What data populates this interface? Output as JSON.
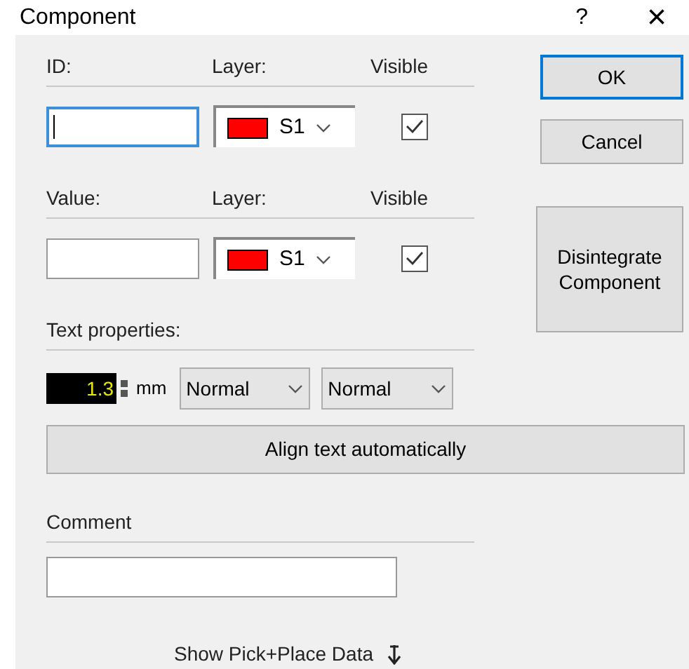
{
  "window": {
    "title": "Component",
    "help": "?",
    "close": "×"
  },
  "fields": [
    {
      "label": "ID:",
      "layer_label": "Layer:",
      "visible_label": "Visible",
      "focused": true,
      "layer": {
        "color": "#ff0000",
        "value": "S1"
      },
      "visible": {
        "checked": true
      }
    },
    {
      "label": "Value:",
      "layer_label": "Layer:",
      "visible_label": "Visible",
      "focused": false,
      "layer": {
        "color": "#ff0000",
        "value": "S1"
      },
      "visible": {
        "checked": true
      }
    }
  ],
  "text_properties": {
    "label": "Text properties:",
    "size": "1.3",
    "unit": "mm",
    "style_1": "Normal",
    "style_2": "Normal"
  },
  "align_button": "Align text automatically",
  "comment": {
    "label": "Comment"
  },
  "buttons": [
    {
      "label": "OK",
      "default": true
    },
    {
      "label": "Cancel",
      "default": false
    }
  ],
  "disintegrate_button": "Disintegrate Component",
  "pick_place_link": "Show Pick+Place Data"
}
